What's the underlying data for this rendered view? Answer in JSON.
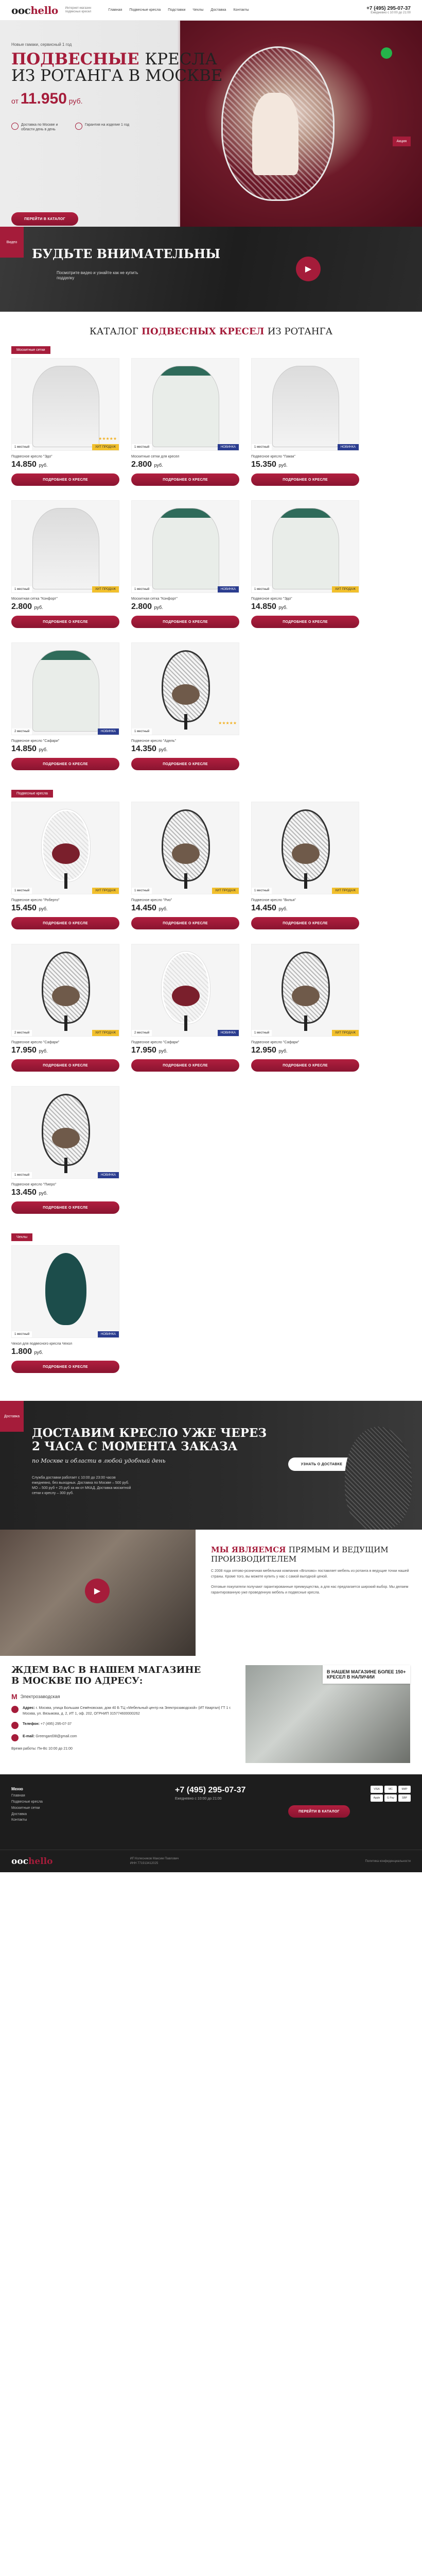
{
  "header": {
    "logo_a": "ooc",
    "logo_b": "hello",
    "logo_sub": "Интернет-магазин подвесных кресел",
    "nav": [
      "Главная",
      "Подвесные кресла",
      "Подставки",
      "Чехлы",
      "Доставка",
      "Контакты"
    ],
    "phone": "+7 (495) 295-07-37",
    "phone_sub": "Ежедневно с 10:00 до 21:00"
  },
  "hero": {
    "tag": "Новые гамаки, сервисный 1 год",
    "title_a": "Подвесные",
    "title_b": "кресла",
    "title_c": "из ротанга в Москве",
    "price_from": "от",
    "price": "11.950",
    "price_unit": "руб.",
    "feats": [
      "Доставка по Москве и области день в день",
      "Гарантия на изделие 1 год"
    ],
    "button": "Перейти в каталог",
    "side": "Акция"
  },
  "video": {
    "label": "Видео",
    "title": "Будьте внимательны",
    "sub": "Посмотрите видео и узнайте как не купить подделку",
    "play": "▶"
  },
  "catalog": {
    "title_a": "Каталог",
    "title_b": "подвесных кресел",
    "title_c": "из ротанга"
  },
  "sections": [
    {
      "label": "Москитные сетки",
      "items": [
        {
          "name": "Подвесное кресло \"Эдо\"",
          "price": "14.850",
          "badge_l": "1 местный",
          "badge_r": "ХИТ ПРОДАЖ",
          "kind": "hit",
          "img": "tent",
          "stars": "★★★★★"
        },
        {
          "name": "Москитные сетки для кресел",
          "price": "2.800",
          "badge_l": "1 местный",
          "badge_r": "НОВИНКА",
          "kind": "new",
          "img": "tent-green",
          "stars": ""
        },
        {
          "name": "Подвесное кресло \"Гамак\"",
          "price": "15.350",
          "badge_l": "1 местный",
          "badge_r": "НОВИНКА",
          "kind": "new",
          "img": "tent",
          "stars": ""
        },
        {
          "name": "Москитная сетка \"Конфорт\"",
          "price": "2.800",
          "badge_l": "1 местный",
          "badge_r": "ХИТ ПРОДАЖ",
          "kind": "hit",
          "img": "tent",
          "stars": ""
        },
        {
          "name": "Москитная сетка \"Конфорт\"",
          "price": "2.800",
          "badge_l": "1 местный",
          "badge_r": "НОВИНКА",
          "kind": "new",
          "img": "tent-green",
          "stars": ""
        },
        {
          "name": "Подвесное кресло \"Эдо\"",
          "price": "14.850",
          "badge_l": "1 местный",
          "badge_r": "ХИТ ПРОДАЖ",
          "kind": "hit",
          "img": "tent-green",
          "stars": ""
        },
        {
          "name": "Подвесное кресло \"Сафари\"",
          "price": "14.850",
          "badge_l": "2 местный",
          "badge_r": "НОВИНКА",
          "kind": "new",
          "img": "tent-green",
          "stars": ""
        },
        {
          "name": "Подвесное кресло \"Адель\"",
          "price": "14.350",
          "badge_l": "1 местный",
          "badge_r": "",
          "kind": "",
          "img": "cocoon",
          "stars": "★★★★★"
        }
      ]
    },
    {
      "label": "Подвесные кресла",
      "items": [
        {
          "name": "Подвесное кресло \"Роберто\"",
          "price": "15.450",
          "badge_l": "1 местный",
          "badge_r": "ХИТ ПРОДАЖ",
          "kind": "hit",
          "img": "cocoon-white",
          "stars": ""
        },
        {
          "name": "Подвесное кресло \"Рио\"",
          "price": "14.450",
          "badge_l": "1 местный",
          "badge_r": "ХИТ ПРОДАЖ",
          "kind": "hit",
          "img": "cocoon",
          "stars": ""
        },
        {
          "name": "Подвесное кресло \"Вилья\"",
          "price": "14.450",
          "badge_l": "1 местный",
          "badge_r": "ХИТ ПРОДАЖ",
          "kind": "hit",
          "img": "cocoon",
          "stars": ""
        },
        {
          "name": "Подвесное кресло \"Сафари\"",
          "price": "17.950",
          "badge_l": "2 местный",
          "badge_r": "ХИТ ПРОДАЖ",
          "kind": "hit",
          "img": "cocoon",
          "stars": ""
        },
        {
          "name": "Подвесное кресло \"Сафари\"",
          "price": "17.950",
          "badge_l": "2 местный",
          "badge_r": "НОВИНКА",
          "kind": "new",
          "img": "cocoon-white",
          "stars": ""
        },
        {
          "name": "Подвесное кресло \"Сафари\"",
          "price": "12.950",
          "badge_l": "1 местный",
          "badge_r": "ХИТ ПРОДАЖ",
          "kind": "hit",
          "img": "cocoon",
          "stars": ""
        },
        {
          "name": "Подвесное кресло \"Пиеро\"",
          "price": "13.450",
          "badge_l": "1 местный",
          "badge_r": "НОВИНКА",
          "kind": "new",
          "img": "cocoon",
          "stars": ""
        }
      ]
    },
    {
      "label": "Чехлы",
      "items": [
        {
          "name": "Чехол для подвесного кресла Чехол",
          "price": "1.800",
          "badge_l": "1 местный",
          "badge_r": "НОВИНКА",
          "kind": "new",
          "img": "teal",
          "stars": ""
        }
      ]
    }
  ],
  "card": {
    "button": "Подробнее о кресле",
    "currency": "руб."
  },
  "delivery": {
    "label": "Доставка",
    "title_a": "Доставим кресло уже через",
    "title_b": "2 часа с момента заказа",
    "sub": "по Москве и области в любой удобный день",
    "text": "Служба доставки работает с 10:00 до 23:00 часов ежедневно, без выходных. Доставка по Москве – 500 руб. МО – 500 руб + 25 руб за км от МКАД. Доставка москитной сетки к креслу – 300 руб.",
    "button": "Узнать о доставке"
  },
  "about": {
    "title_a": "Мы являемся",
    "title_b": "прямым и ведущим",
    "title_c": "производителем",
    "p1": "С 2008 года оптово-розничная мебельная компания «Вголово» поставляет мебель из ротанга в ведущие точки нашей страны. Кроме того, вы можете купить у нас с самой выгодной ценой.",
    "p2": "Оптовые покупатели получают гарантированные преимущества, а для нас предлагается широкий выбор. Мы делаем гарантированную уже проведенную мебель и подвесные кресла.",
    "play": "▶"
  },
  "store": {
    "title_a": "Ждем вас в нашем магазине",
    "title_b": "в Москве по адресу:",
    "metro": "Электрозаводская",
    "metro_sym": "М",
    "addr_label": "Адрес:",
    "addr": "г. Москва, улица Большая Семёновская, дом 40 Б ТЦ «Мебельный центр на Электрозаводской» (ИТ Квартал) ГТ 1 г. Москва, ул. Вязьмова, д. 2, ИТ 1, оф. 202, ОГРНИП 315774600000262",
    "phone_label": "Телефон:",
    "phone": "+7 (495) 295-07-37",
    "email_label": "E-mail:",
    "email": "Greengard38@gmail.com",
    "hours": "Время работы: Пн-Вс 10:00 до 21:00",
    "banner": "В нашем магазине более 150+ кресел в наличии"
  },
  "footer": {
    "menu_title": "Меню",
    "menu": [
      "Главная",
      "Подвесные кресла",
      "Москитные сетки",
      "Доставка",
      "Контакты"
    ],
    "phone": "+7 (495) 295-07-37",
    "phone_sub": "Ежедневно с 10:00 до 21:00",
    "button": "Перейти в каталог",
    "pay": [
      "VISA",
      "MC",
      "МИР",
      "Apple",
      "G Pay",
      "SBP"
    ],
    "logo_a": "ooc",
    "logo_b": "hello",
    "copy": "ИП Колесников Максим Павлович\nИНН 771913412025",
    "policy": "Политика конфиденциальности"
  }
}
